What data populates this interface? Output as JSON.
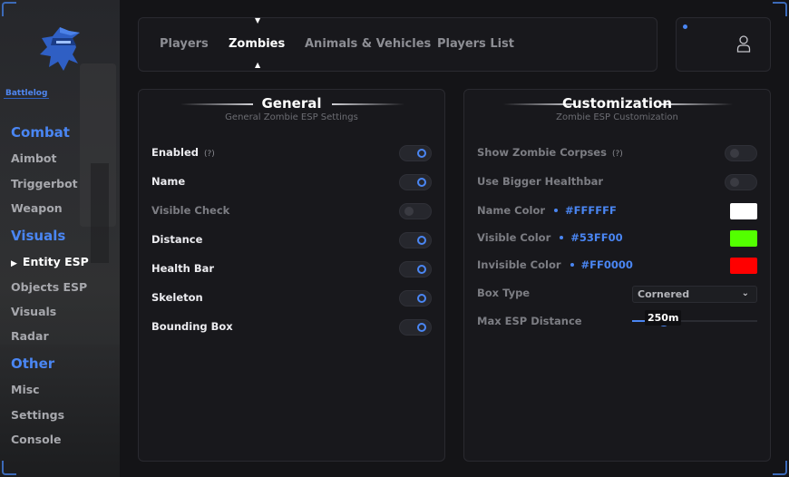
{
  "sidebar": {
    "brand": "Battlelog",
    "sections": [
      {
        "label": "Combat",
        "items": [
          "Aimbot",
          "Triggerbot",
          "Weapon"
        ]
      },
      {
        "label": "Visuals",
        "items": [
          "Entity ESP",
          "Objects ESP",
          "Visuals",
          "Radar"
        ]
      },
      {
        "label": "Other",
        "items": [
          "Misc",
          "Settings",
          "Console"
        ]
      }
    ],
    "active_item": "Entity ESP",
    "active_marker": "▶"
  },
  "tabs": [
    "Players",
    "Zombies",
    "Animals & Vehicles",
    "Players List"
  ],
  "active_tab": "Zombies",
  "tab_indicators": {
    "top": "▼",
    "bottom": "▲"
  },
  "general": {
    "title": "General",
    "subtitle": "General Zombie ESP Settings",
    "rows": [
      {
        "label": "Enabled",
        "hint": "(?)",
        "on": true
      },
      {
        "label": "Name",
        "on": true
      },
      {
        "label": "Visible Check",
        "on": false
      },
      {
        "label": "Distance",
        "on": true
      },
      {
        "label": "Health Bar",
        "on": true
      },
      {
        "label": "Skeleton",
        "on": true
      },
      {
        "label": "Bounding Box",
        "on": true
      }
    ]
  },
  "customization": {
    "title": "Customization",
    "subtitle": "Zombie ESP Customization",
    "toggles": [
      {
        "label": "Show Zombie Corpses",
        "hint": "(?)",
        "on": false
      },
      {
        "label": "Use Bigger Healthbar",
        "on": false
      }
    ],
    "colors": [
      {
        "label": "Name Color",
        "hex": "#FFFFFF",
        "color": "#FFFFFF"
      },
      {
        "label": "Visible Color",
        "hex": "#53FF00",
        "color": "#53FF00"
      },
      {
        "label": "Invisible Color",
        "hex": "#FF0000",
        "color": "#FF0000"
      }
    ],
    "box_type": {
      "label": "Box Type",
      "value": "Cornered"
    },
    "max_distance": {
      "label": "Max ESP Distance",
      "value": "250m",
      "fraction": 0.25
    }
  },
  "colors": {
    "accent": "#4A86F3",
    "background": "#141417",
    "panel": "#18181C"
  }
}
